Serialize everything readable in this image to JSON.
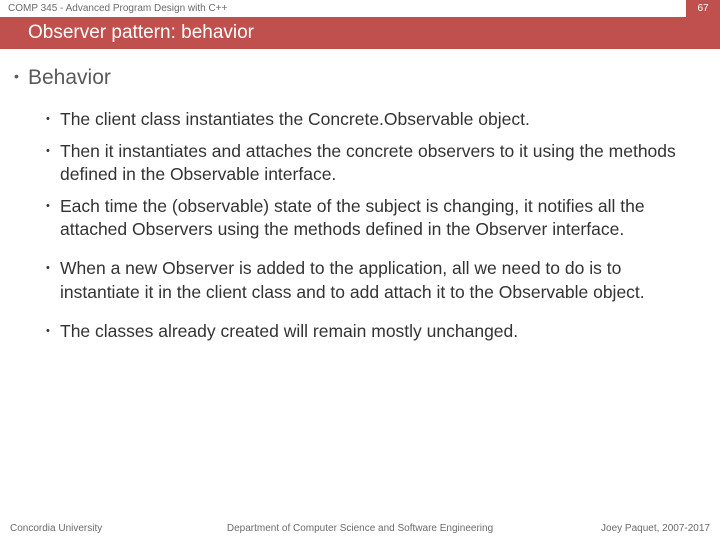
{
  "header": {
    "course": "COMP 345 - Advanced Program Design with C++",
    "page": "67",
    "title": "Observer pattern: behavior"
  },
  "content": {
    "heading": "Behavior",
    "bullets": [
      "The client class instantiates the Concrete.Observable object.",
      "Then it instantiates and attaches the concrete observers to it using the methods defined in the Observable interface.",
      "Each time the (observable) state of the subject is changing, it notifies all the attached Observers using the methods defined in the Observer interface.",
      "When a new Observer is added to the application, all we need to do is to instantiate it in the client class and to add attach it to the Observable object.",
      "The classes already created will remain mostly unchanged."
    ]
  },
  "footer": {
    "left": "Concordia University",
    "center": "Department of Computer Science and Software Engineering",
    "right": "Joey Paquet, 2007-2017"
  }
}
